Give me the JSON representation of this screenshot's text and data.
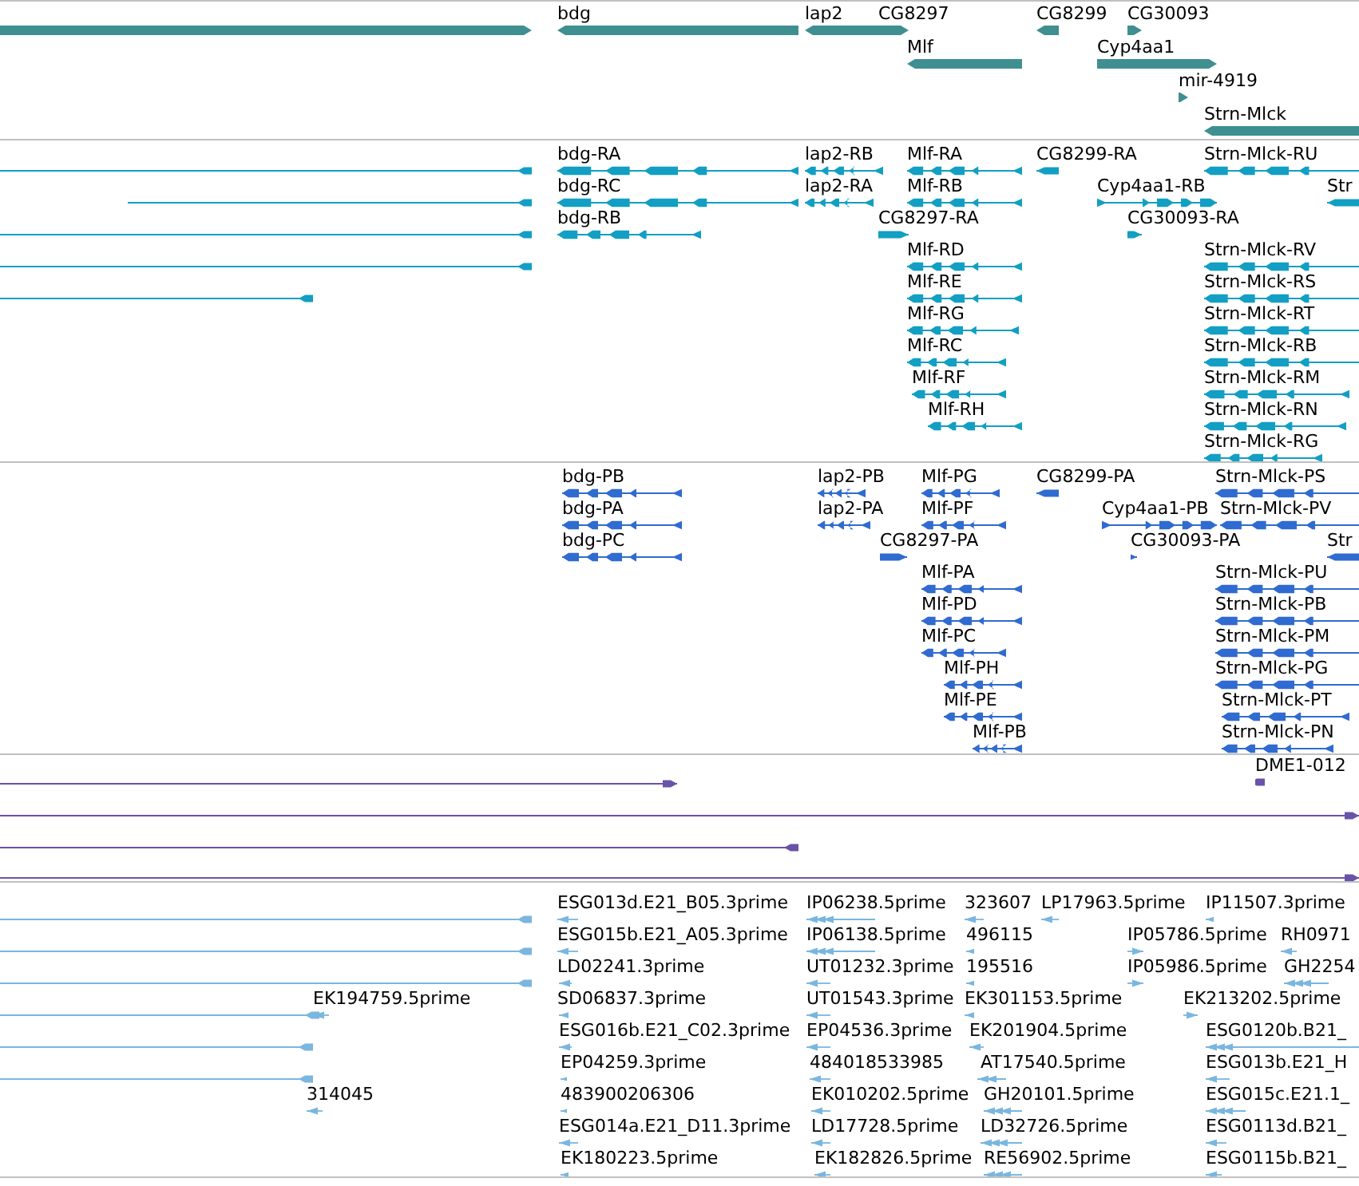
{
  "tracks": [
    {
      "kind": "gene",
      "features": [
        {
          "reverse": false
        },
        {
          "label": "bdg",
          "reverse": true
        },
        {
          "label": "lap2",
          "reverse": true
        },
        {
          "label": "CG8297",
          "reverse": false
        },
        {
          "label": "CG8299",
          "reverse": true
        },
        {
          "label": "CG30093",
          "reverse": false
        },
        {
          "label": "Mlf",
          "reverse": true
        },
        {
          "label": "Cyp4aa1",
          "reverse": false
        },
        {
          "label": "mir-4919",
          "reverse": false
        },
        {
          "label": "Strn-Mlck",
          "reverse": true
        }
      ]
    },
    {
      "kind": "transcript",
      "features": [
        {
          "reverse": true
        },
        {
          "reverse": true
        },
        {
          "reverse": true
        },
        {
          "reverse": true
        },
        {
          "reverse": true
        },
        {
          "label": "bdg-RA",
          "reverse": true
        },
        {
          "label": "bdg-RC",
          "reverse": true
        },
        {
          "label": "bdg-RB",
          "reverse": true
        },
        {
          "label": "lap2-RB",
          "reverse": true
        },
        {
          "label": "lap2-RA",
          "reverse": true
        },
        {
          "label": "Mlf-RA",
          "reverse": true
        },
        {
          "label": "Mlf-RB",
          "reverse": true
        },
        {
          "label": "CG8297-RA",
          "reverse": false
        },
        {
          "label": "Mlf-RD",
          "reverse": true
        },
        {
          "label": "Mlf-RE",
          "reverse": true
        },
        {
          "label": "Mlf-RG",
          "reverse": true
        },
        {
          "label": "Mlf-RC",
          "reverse": true
        },
        {
          "label": "Mlf-RF",
          "reverse": true
        },
        {
          "label": "Mlf-RH",
          "reverse": true
        },
        {
          "label": "CG8299-RA",
          "reverse": true
        },
        {
          "label": "Cyp4aa1-RB",
          "reverse": false
        },
        {
          "label": "CG30093-RA",
          "reverse": false
        },
        {
          "label": "Strn-Mlck-RU",
          "reverse": true
        },
        {
          "label": "Str",
          "reverse": true
        },
        {
          "label": "Strn-Mlck-RV",
          "reverse": true
        },
        {
          "label": "Strn-Mlck-RS",
          "reverse": true
        },
        {
          "label": "Strn-Mlck-RT",
          "reverse": true
        },
        {
          "label": "Strn-Mlck-RB",
          "reverse": true
        },
        {
          "label": "Strn-Mlck-RM",
          "reverse": true
        },
        {
          "label": "Strn-Mlck-RN",
          "reverse": true
        },
        {
          "label": "Strn-Mlck-RG",
          "reverse": true
        }
      ]
    },
    {
      "kind": "protein",
      "features": [
        {
          "label": "bdg-PB",
          "reverse": true
        },
        {
          "label": "bdg-PA",
          "reverse": true
        },
        {
          "label": "bdg-PC",
          "reverse": true
        },
        {
          "label": "lap2-PB",
          "reverse": true
        },
        {
          "label": "lap2-PA",
          "reverse": true
        },
        {
          "label": "Mlf-PG",
          "reverse": true
        },
        {
          "label": "Mlf-PF",
          "reverse": true
        },
        {
          "label": "CG8297-PA",
          "reverse": false
        },
        {
          "label": "Mlf-PA",
          "reverse": true
        },
        {
          "label": "Mlf-PD",
          "reverse": true
        },
        {
          "label": "Mlf-PC",
          "reverse": true
        },
        {
          "label": "Mlf-PH",
          "reverse": true
        },
        {
          "label": "Mlf-PE",
          "reverse": true
        },
        {
          "label": "Mlf-PB",
          "reverse": true
        },
        {
          "label": "CG8299-PA",
          "reverse": true
        },
        {
          "label": "Cyp4aa1-PB",
          "reverse": false
        },
        {
          "label": "CG30093-PA",
          "reverse": false
        },
        {
          "label": "Strn-Mlck-PS",
          "reverse": true
        },
        {
          "label": "Strn-Mlck-PV",
          "reverse": true
        },
        {
          "label": "Str",
          "reverse": true
        },
        {
          "label": "Strn-Mlck-PU",
          "reverse": true
        },
        {
          "label": "Strn-Mlck-PB",
          "reverse": true
        },
        {
          "label": "Strn-Mlck-PM",
          "reverse": true
        },
        {
          "label": "Strn-Mlck-PG",
          "reverse": true
        },
        {
          "label": "Strn-Mlck-PT",
          "reverse": true
        },
        {
          "label": "Strn-Mlck-PN",
          "reverse": true
        }
      ]
    },
    {
      "kind": "match",
      "features": [
        {
          "reverse": false
        },
        {
          "label": "DME1-012",
          "reverse": true
        },
        {
          "reverse": false
        },
        {
          "reverse": true
        },
        {
          "reverse": false
        }
      ]
    },
    {
      "kind": "est",
      "features": [
        {
          "reverse": true
        },
        {
          "reverse": true
        },
        {
          "reverse": true
        },
        {
          "reverse": true
        },
        {
          "reverse": true
        },
        {
          "reverse": true
        },
        {
          "label": "EK194759.5prime",
          "reverse": true
        },
        {
          "label": "314045",
          "reverse": true
        },
        {
          "label": "ESG013d.E21_B05.3prime",
          "reverse": true
        },
        {
          "label": "ESG015b.E21_A05.3prime",
          "reverse": true
        },
        {
          "label": "LD02241.3prime",
          "reverse": true
        },
        {
          "label": "SD06837.3prime",
          "reverse": true
        },
        {
          "label": "ESG016b.E21_C02.3prime",
          "reverse": true
        },
        {
          "label": "EP04259.3prime",
          "reverse": true
        },
        {
          "label": "483900206306",
          "reverse": true
        },
        {
          "label": "ESG014a.E21_D11.3prime",
          "reverse": true
        },
        {
          "label": "EK180223.5prime",
          "reverse": true
        },
        {
          "label": "IP06238.5prime",
          "reverse": true
        },
        {
          "label": "IP06138.5prime",
          "reverse": true
        },
        {
          "label": "UT01232.3prime",
          "reverse": true
        },
        {
          "label": "UT01543.3prime",
          "reverse": true
        },
        {
          "label": "EP04536.3prime",
          "reverse": true
        },
        {
          "label": "484018533985",
          "reverse": true
        },
        {
          "label": "EK010202.5prime",
          "reverse": true
        },
        {
          "label": "LD17728.5prime",
          "reverse": true
        },
        {
          "label": "EK182826.5prime",
          "reverse": true
        },
        {
          "label": "323607",
          "reverse": true
        },
        {
          "label": "496115",
          "reverse": true
        },
        {
          "label": "195516",
          "reverse": true
        },
        {
          "label": "EK301153.5prime",
          "reverse": true
        },
        {
          "label": "EK201904.5prime",
          "reverse": true
        },
        {
          "label": "AT17540.5prime",
          "reverse": true
        },
        {
          "label": "GH20101.5prime",
          "reverse": true
        },
        {
          "label": "LD32726.5prime",
          "reverse": true
        },
        {
          "label": "RE56902.5prime",
          "reverse": true
        },
        {
          "label": "LP17963.5prime",
          "reverse": true
        },
        {
          "label": "IP11507.3prime",
          "reverse": true
        },
        {
          "label": "IP05786.5prime",
          "reverse": false
        },
        {
          "label": "RH0971",
          "reverse": true
        },
        {
          "label": "IP05986.5prime",
          "reverse": false
        },
        {
          "label": "GH2254",
          "reverse": true
        },
        {
          "label": "EK213202.5prime",
          "reverse": false
        },
        {
          "label": "ESG0120b.B21_",
          "reverse": true
        },
        {
          "label": "ESG013b.E21_H",
          "reverse": true
        },
        {
          "label": "ESG015c.E21.1_",
          "reverse": true
        },
        {
          "label": "ESG0113d.B21_",
          "reverse": true
        },
        {
          "label": "ESG0115b.B21_",
          "reverse": true
        }
      ]
    }
  ]
}
